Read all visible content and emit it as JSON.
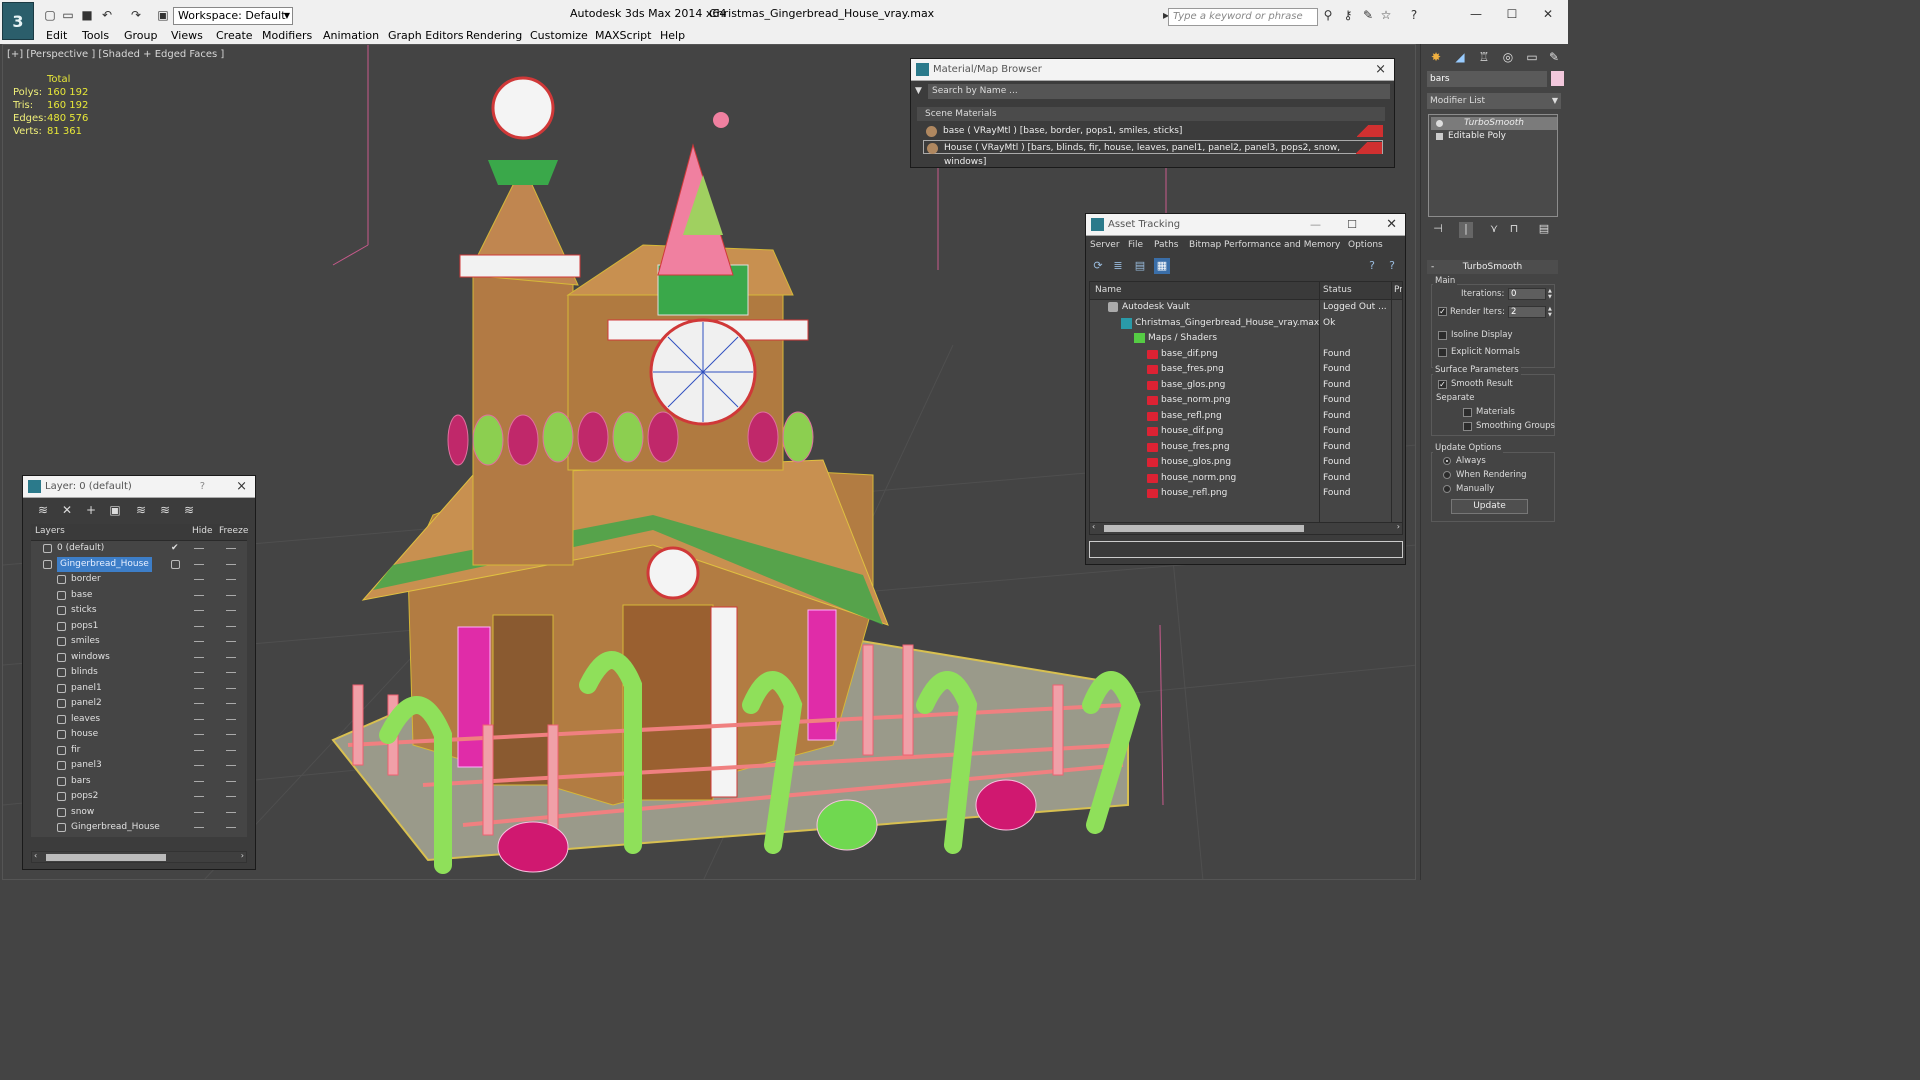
{
  "app": {
    "logo": "3",
    "title": "Autodesk 3ds Max  2014 x64",
    "file": "Christmas_Gingerbread_House_vray.max",
    "workspace": "Workspace: Default",
    "search_placeholder": "Type a keyword or phrase"
  },
  "menu": [
    "Edit",
    "Tools",
    "Group",
    "Views",
    "Create",
    "Modifiers",
    "Animation",
    "Graph Editors",
    "Rendering",
    "Customize",
    "MAXScript",
    "Help"
  ],
  "viewport": {
    "label": "[+] [Perspective ] [Shaded + Edged Faces ]",
    "stats": {
      "header": "Total",
      "rows": [
        {
          "k": "Polys:",
          "v": "160 192"
        },
        {
          "k": "Tris:",
          "v": "160 192"
        },
        {
          "k": "Edges:",
          "v": "480 576"
        },
        {
          "k": "Verts:",
          "v": "81 361"
        }
      ]
    }
  },
  "layer_window": {
    "title": "Layer: 0 (default)",
    "help": "?",
    "close": "×",
    "col_layers": "Layers",
    "col_hide": "Hide",
    "col_freeze": "Freeze",
    "rows": [
      {
        "name": "0 (default)",
        "check": "✔"
      },
      {
        "name": "Gingerbread_House",
        "selected": true
      },
      {
        "name": "border"
      },
      {
        "name": "base"
      },
      {
        "name": "sticks"
      },
      {
        "name": "pops1"
      },
      {
        "name": "smiles"
      },
      {
        "name": "windows"
      },
      {
        "name": "blinds"
      },
      {
        "name": "panel1"
      },
      {
        "name": "panel2"
      },
      {
        "name": "leaves"
      },
      {
        "name": "house"
      },
      {
        "name": "fir"
      },
      {
        "name": "panel3"
      },
      {
        "name": "bars"
      },
      {
        "name": "pops2"
      },
      {
        "name": "snow"
      },
      {
        "name": "Gingerbread_House"
      }
    ]
  },
  "material_browser": {
    "title": "Material/Map Browser",
    "close": "×",
    "search": "Search by Name ...",
    "section": "Scene Materials",
    "items": [
      "base  ( VRayMtl ) [base, border, pops1, smiles, sticks]",
      "House  ( VRayMtl ) [bars, blinds, fir, house, leaves, panel1, panel2, panel3, pops2, snow, windows]"
    ]
  },
  "asset_tracking": {
    "title": "Asset Tracking",
    "menu": [
      "Server",
      "File",
      "Paths",
      "Bitmap Performance and Memory",
      "Options"
    ],
    "col_name": "Name",
    "col_status": "Status",
    "col_extra": "Pr",
    "rows": [
      {
        "name": "Autodesk Vault",
        "status": "Logged Out ...",
        "indent": 0,
        "icon": "vault"
      },
      {
        "name": "Christmas_Gingerbread_House_vray.max",
        "status": "Ok",
        "indent": 1,
        "icon": "file"
      },
      {
        "name": "Maps / Shaders",
        "status": "",
        "indent": 2,
        "icon": "map"
      },
      {
        "name": "base_dif.png",
        "status": "Found",
        "indent": 3,
        "icon": "png"
      },
      {
        "name": "base_fres.png",
        "status": "Found",
        "indent": 3,
        "icon": "png"
      },
      {
        "name": "base_glos.png",
        "status": "Found",
        "indent": 3,
        "icon": "png"
      },
      {
        "name": "base_norm.png",
        "status": "Found",
        "indent": 3,
        "icon": "png"
      },
      {
        "name": "base_refl.png",
        "status": "Found",
        "indent": 3,
        "icon": "png"
      },
      {
        "name": "house_dif.png",
        "status": "Found",
        "indent": 3,
        "icon": "png"
      },
      {
        "name": "house_fres.png",
        "status": "Found",
        "indent": 3,
        "icon": "png"
      },
      {
        "name": "house_glos.png",
        "status": "Found",
        "indent": 3,
        "icon": "png"
      },
      {
        "name": "house_norm.png",
        "status": "Found",
        "indent": 3,
        "icon": "png"
      },
      {
        "name": "house_refl.png",
        "status": "Found",
        "indent": 3,
        "icon": "png"
      }
    ]
  },
  "command_panel": {
    "object_name": "bars",
    "object_color": "#f2c8dc",
    "modifier_list": "Modifier List",
    "stack": [
      "TurboSmooth",
      "Editable Poly"
    ],
    "rollout": "TurboSmooth",
    "main_group": "Main",
    "iterations_label": "Iterations:",
    "iterations_value": "0",
    "render_iters_label": "Render Iters:",
    "render_iters_value": "2",
    "isoline": "Isoline Display",
    "explicit_normals": "Explicit Normals",
    "surface_group": "Surface Parameters",
    "smooth_result": "Smooth Result",
    "separate": "Separate",
    "materials": "Materials",
    "smoothing_groups": "Smoothing Groups",
    "update_group": "Update Options",
    "always": "Always",
    "when_rendering": "When Rendering",
    "manually": "Manually",
    "update_button": "Update"
  }
}
